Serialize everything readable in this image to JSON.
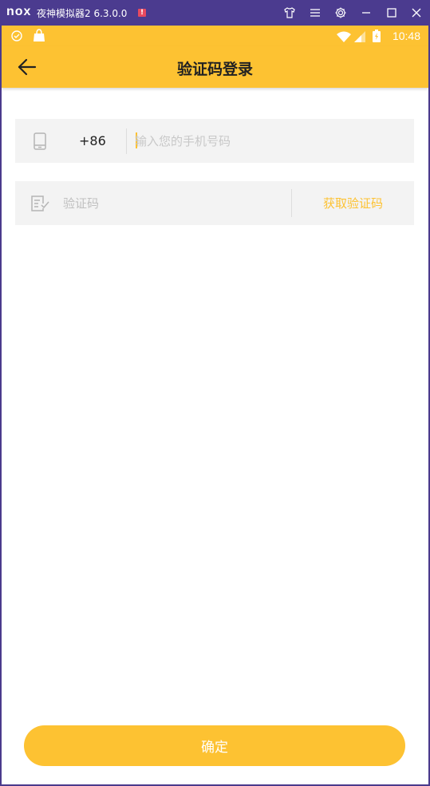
{
  "emulator": {
    "logo": "nox",
    "title": "夜神模拟器2 6.3.0.0",
    "alert": "!",
    "controls": [
      "shirt-icon",
      "menu-icon",
      "gear-icon",
      "minimize-icon",
      "maximize-icon",
      "close-icon"
    ]
  },
  "status_bar": {
    "time": "10:48",
    "icons": [
      "nox-badge-icon",
      "bag-icon",
      "wifi-icon",
      "signal-icon",
      "battery-icon"
    ]
  },
  "app_bar": {
    "title": "验证码登录",
    "back_icon": "arrow-left-icon"
  },
  "phone_field": {
    "icon": "phone-icon",
    "country_code": "+86",
    "value": "",
    "placeholder": "输入您的手机号码"
  },
  "code_field": {
    "icon": "edit-check-icon",
    "value": "",
    "placeholder": "验证码",
    "get_code_label": "获取验证码"
  },
  "confirm_label": "确定",
  "colors": {
    "accent": "#fdc232",
    "field_bg": "#f3f3f3",
    "emulator_bar": "#4b3b8f"
  }
}
